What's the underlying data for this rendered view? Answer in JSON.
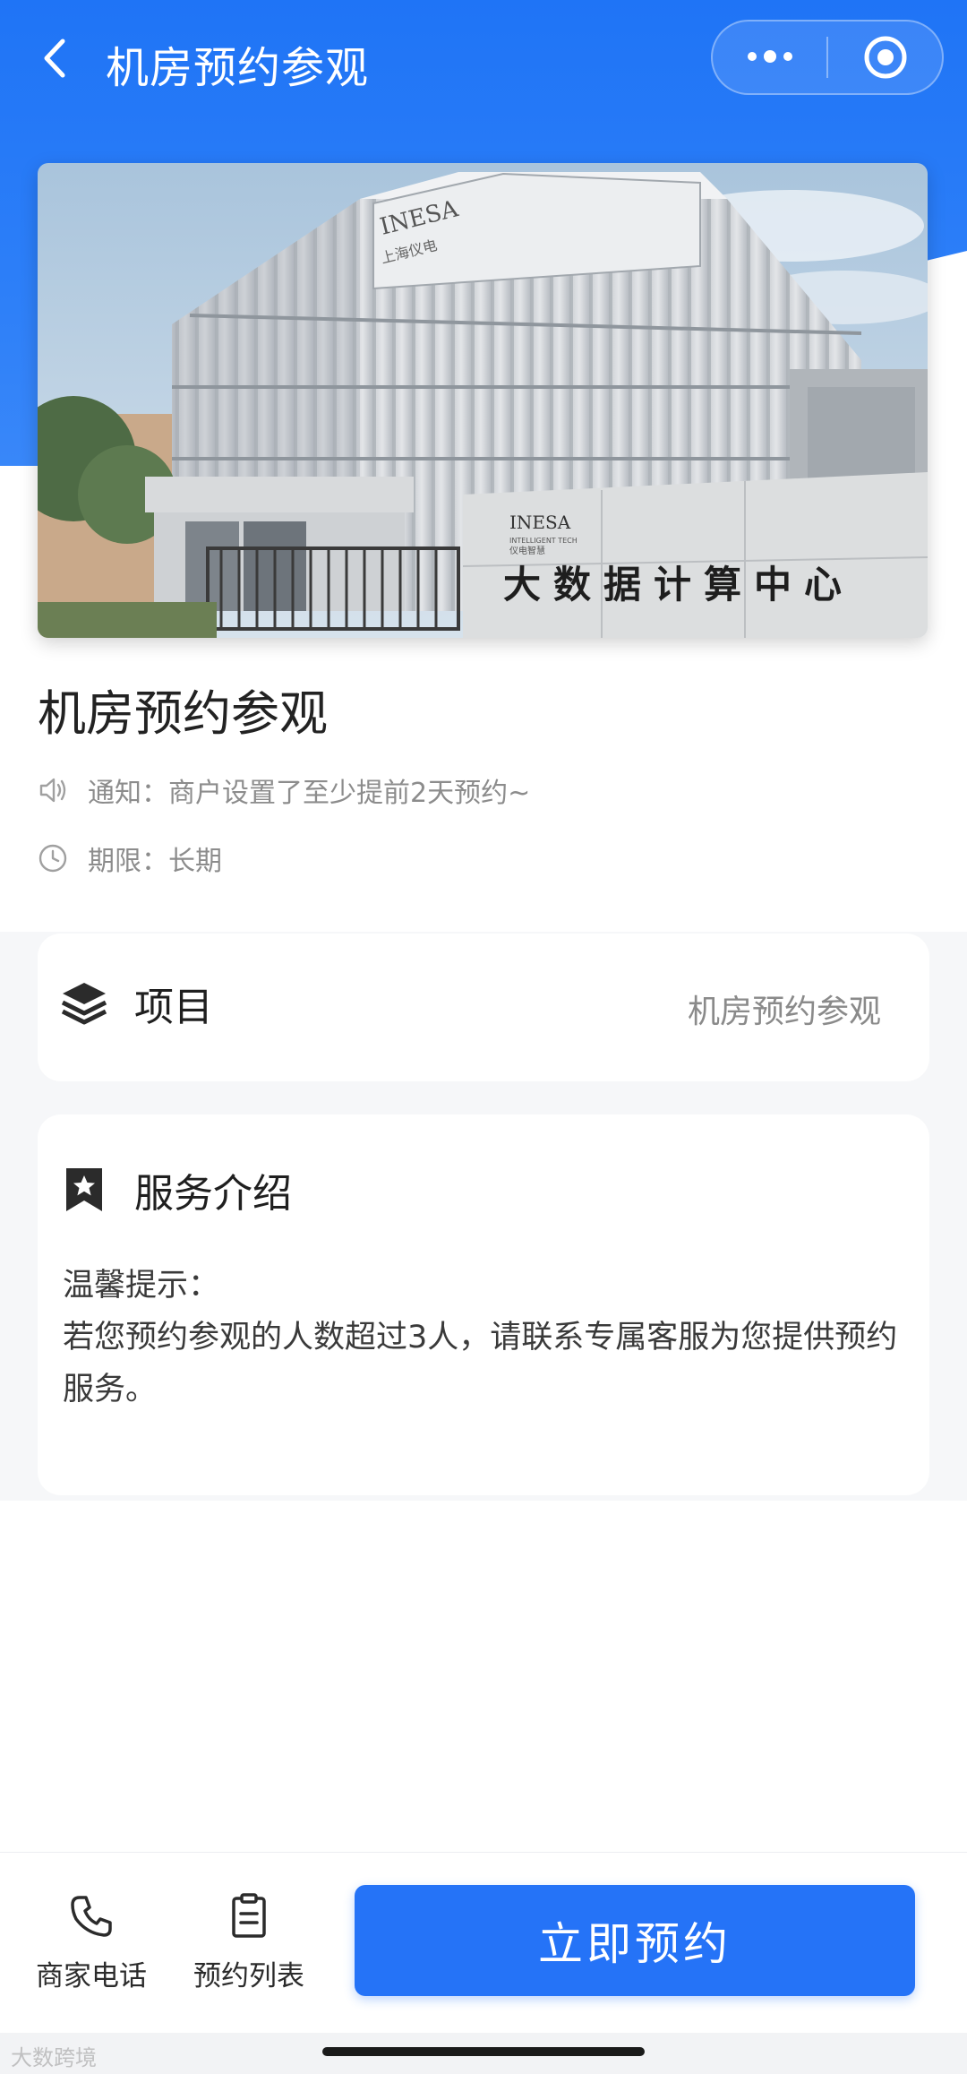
{
  "nav": {
    "title": "机房预约参观"
  },
  "banner": {
    "building_brand": "INESA",
    "building_brand_sub": "上海仪电",
    "wall_brand_sub": "INTELLIGENT TECH",
    "wall_brand_cn": "仪电智慧",
    "wall_sign": "大数据计算中心"
  },
  "detail": {
    "title": "机房预约参观",
    "notice_label": "通知：",
    "notice_text": "商户设置了至少提前2天预约~",
    "period_label": "期限：",
    "period_text": "长期"
  },
  "project_card": {
    "label": "项目",
    "value": "机房预约参观"
  },
  "service_card": {
    "label": "服务介绍",
    "tip_title": "温馨提示：",
    "tip_body": "若您预约参观的人数超过3人，请联系专属客服为您提供预约服务。"
  },
  "footer": {
    "phone_label": "商家电话",
    "list_label": "预约列表",
    "book_label": "立即预约"
  },
  "watermark": "大数跨境",
  "colors": {
    "primary": "#2573f7",
    "header_blue": "#1f74f6",
    "text_muted": "#8c8c8c"
  }
}
